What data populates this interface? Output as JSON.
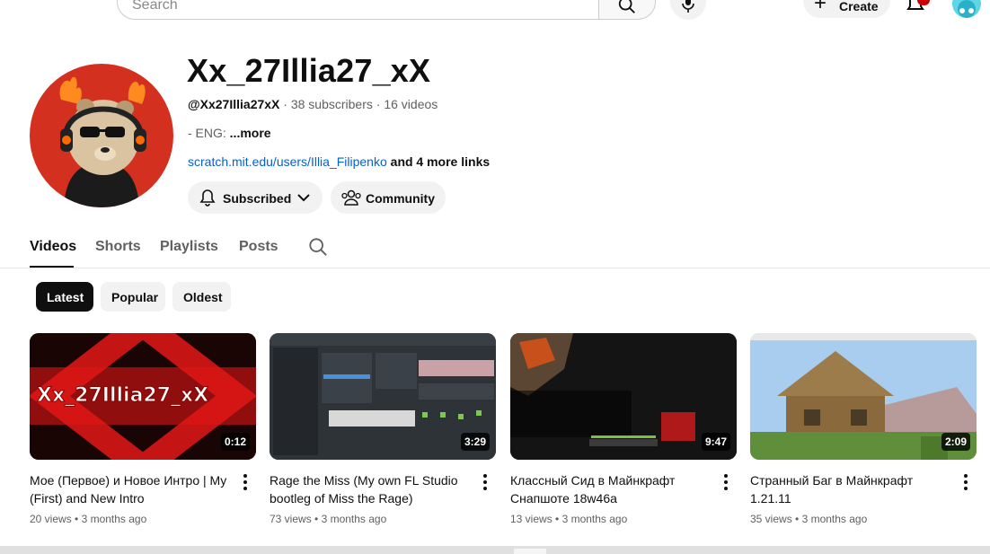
{
  "topbar": {
    "search_placeholder": "Search",
    "create_label": "Create"
  },
  "channel": {
    "name": "Xx_27Illia27_xX",
    "handle": "@Xx27Illia27xX",
    "subscribers": "38 subscribers",
    "videos": "16 videos",
    "separator": "·",
    "description": "- ENG:",
    "description_more": "...more",
    "link": "scratch.mit.edu/users/Illia_Filipenko",
    "more_links": "and 4 more links",
    "subscribed_label": "Subscribed",
    "community_label": "Community"
  },
  "tabs": [
    {
      "label": "Videos",
      "active": true
    },
    {
      "label": "Shorts",
      "active": false
    },
    {
      "label": "Playlists",
      "active": false
    },
    {
      "label": "Posts",
      "active": false
    }
  ],
  "chips": [
    {
      "label": "Latest",
      "active": true
    },
    {
      "label": "Popular",
      "active": false
    },
    {
      "label": "Oldest",
      "active": false
    }
  ],
  "videos": [
    {
      "title": "Мое (Первое) и Новое Интро | My (First) and New Intro",
      "duration": "0:12",
      "views": "20 views",
      "age": "3 months ago",
      "thumb_text": "Xx_27Illia27_xX"
    },
    {
      "title": "Rage the Miss (My own FL Studio bootleg of Miss the Rage)",
      "duration": "3:29",
      "views": "73 views",
      "age": "3 months ago"
    },
    {
      "title": "Классный Сид в Майнкрафт Снапшоте 18w46a",
      "duration": "9:47",
      "views": "13 views",
      "age": "3 months ago"
    },
    {
      "title": "Странный Баг в Майнкрафт 1.21.11",
      "duration": "2:09",
      "views": "35 views",
      "age": "3 months ago"
    }
  ],
  "colors": {
    "accent_link": "#065fd4",
    "avatar_bg": "#d4301f",
    "notification_badge": "#cc0000"
  }
}
